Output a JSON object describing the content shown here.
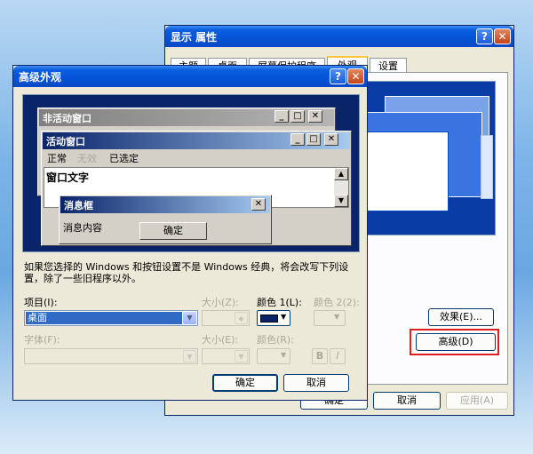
{
  "display_props": {
    "title": "显示 属性",
    "tabs": [
      "主题",
      "桌面",
      "屏幕保护程序",
      "外观",
      "设置"
    ],
    "effects_button": "效果(E)...",
    "advanced_button": "高级(D)",
    "ok_button": "确定",
    "cancel_button": "取消",
    "apply_button": "应用(A)"
  },
  "advanced": {
    "title": "高级外观",
    "inactive_window_title": "非活动窗口",
    "active_window_title": "活动窗口",
    "menu_items": [
      "正常",
      "无效",
      "已选定"
    ],
    "window_text": "窗口文字",
    "msgbox_title": "消息框",
    "msgbox_content": "消息内容",
    "msgbox_ok": "确定",
    "info_text": "如果您选择的 Windows 和按钮设置不是 Windows 经典，将会改写下列设置，除了一些旧程序以外。",
    "item_label": "项目(I):",
    "item_value": "桌面",
    "size_label": "大小(Z):",
    "color1_label": "颜色 1(L):",
    "color2_label": "颜色 2(2):",
    "font_label": "字体(F):",
    "font_size_label": "大小(E):",
    "font_color_label": "颜色(R):",
    "bold_label": "B",
    "italic_label": "I",
    "ok_button": "确定",
    "cancel_button": "取消",
    "desktop_color": "#0a246a"
  },
  "caption": {
    "help": "?",
    "close": "✕",
    "minimize": "_",
    "maximize": "□"
  }
}
